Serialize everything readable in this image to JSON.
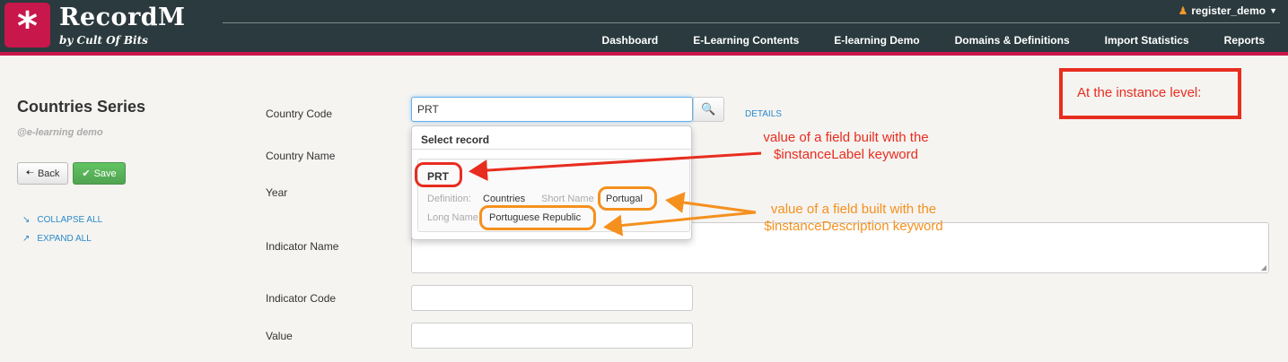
{
  "header": {
    "logo_symbol": "*",
    "app_name": "RecordM",
    "tagline": "by Cult Of Bits",
    "user": "register_demo",
    "nav": [
      "Dashboard",
      "E-Learning Contents",
      "E-learning Demo",
      "Domains & Definitions",
      "Import Statistics",
      "Reports"
    ]
  },
  "sidebar": {
    "title": "Countries Series",
    "subtitle": "@e-learning demo",
    "back_label": "Back",
    "save_label": "Save",
    "collapse_label": "COLLAPSE ALL",
    "expand_label": "EXPAND ALL"
  },
  "form": {
    "country_code_label": "Country Code",
    "country_code_value": "PRT",
    "details_label": "DETAILS",
    "country_name_label": "Country Name",
    "year_label": "Year",
    "indicator_name_label": "Indicator Name",
    "indicator_code_label": "Indicator Code",
    "value_label": "Value"
  },
  "dropdown": {
    "header": "Select record",
    "record_label": "PRT",
    "definition_label": "Definition:",
    "definition_value": "Countries",
    "short_name_label": "Short Name",
    "short_name_value": "Portugal",
    "long_name_label": "Long Name",
    "long_name_value": "Portuguese Republic"
  },
  "annotations": {
    "box_text": "At the instance level:",
    "label_line1": "value of a field built with the",
    "label_line2": "$instanceLabel keyword",
    "desc_line1": "value of a field built with the",
    "desc_line2": "$instanceDescription keyword"
  },
  "colors": {
    "header_bg": "#2b3a3e",
    "brand": "#c8174a",
    "annotation_red": "#e82d1f",
    "annotation_orange": "#f5901e",
    "link": "#2a8ac9",
    "save_green": "#51a351"
  }
}
